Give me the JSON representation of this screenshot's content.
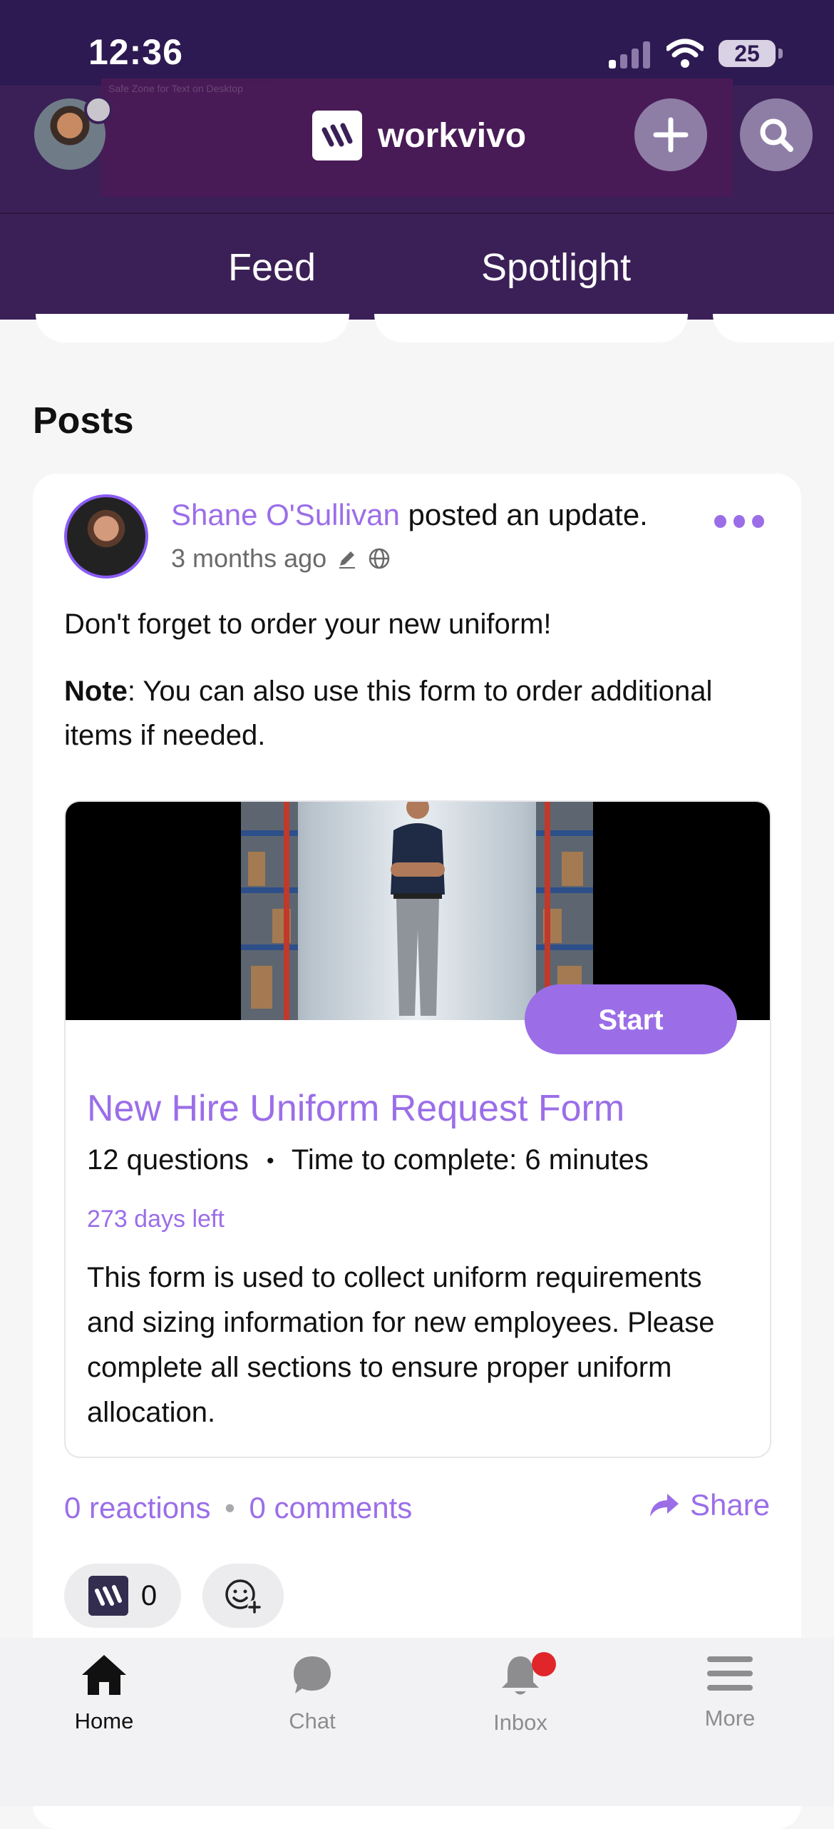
{
  "status_bar": {
    "time": "12:36",
    "battery": "25"
  },
  "header": {
    "brand": "workvivo",
    "safe_zone_note": "Safe Zone for Text on Desktop"
  },
  "tabs": [
    {
      "label": "Feed"
    },
    {
      "label": "Spotlight",
      "active": true
    }
  ],
  "section_title": "Posts",
  "post": {
    "author": "Shane O'Sullivan",
    "action": " posted an update.",
    "time": "3 months ago",
    "line1": "Don't forget to order your new uniform!",
    "note_label": "Note",
    "note_text": ": You can also use this form to order additional items if needed.",
    "attachment": {
      "button": "Start",
      "title": "New Hire Uniform Request Form",
      "questions": "12 questions",
      "separator": "•",
      "time_to_complete": "Time to complete: 6 minutes",
      "days_left": "273 days left",
      "description": "This form is used to collect uniform requirements and sizing information for new employees. Please complete all sections to ensure proper uniform allocation."
    },
    "reactions": "0 reactions",
    "stat_separator": "•",
    "comments": "0 comments",
    "share": "Share",
    "reaction_count": "0"
  },
  "bottom_nav": [
    {
      "label": "Home",
      "icon": "home-icon",
      "active": true
    },
    {
      "label": "Chat",
      "icon": "chat-icon"
    },
    {
      "label": "Inbox",
      "icon": "bell-icon",
      "badge": true
    },
    {
      "label": "More",
      "icon": "menu-icon"
    }
  ],
  "colors": {
    "header": "#3b2057",
    "accent": "#9b6ee8",
    "badge": "#e0262a"
  }
}
